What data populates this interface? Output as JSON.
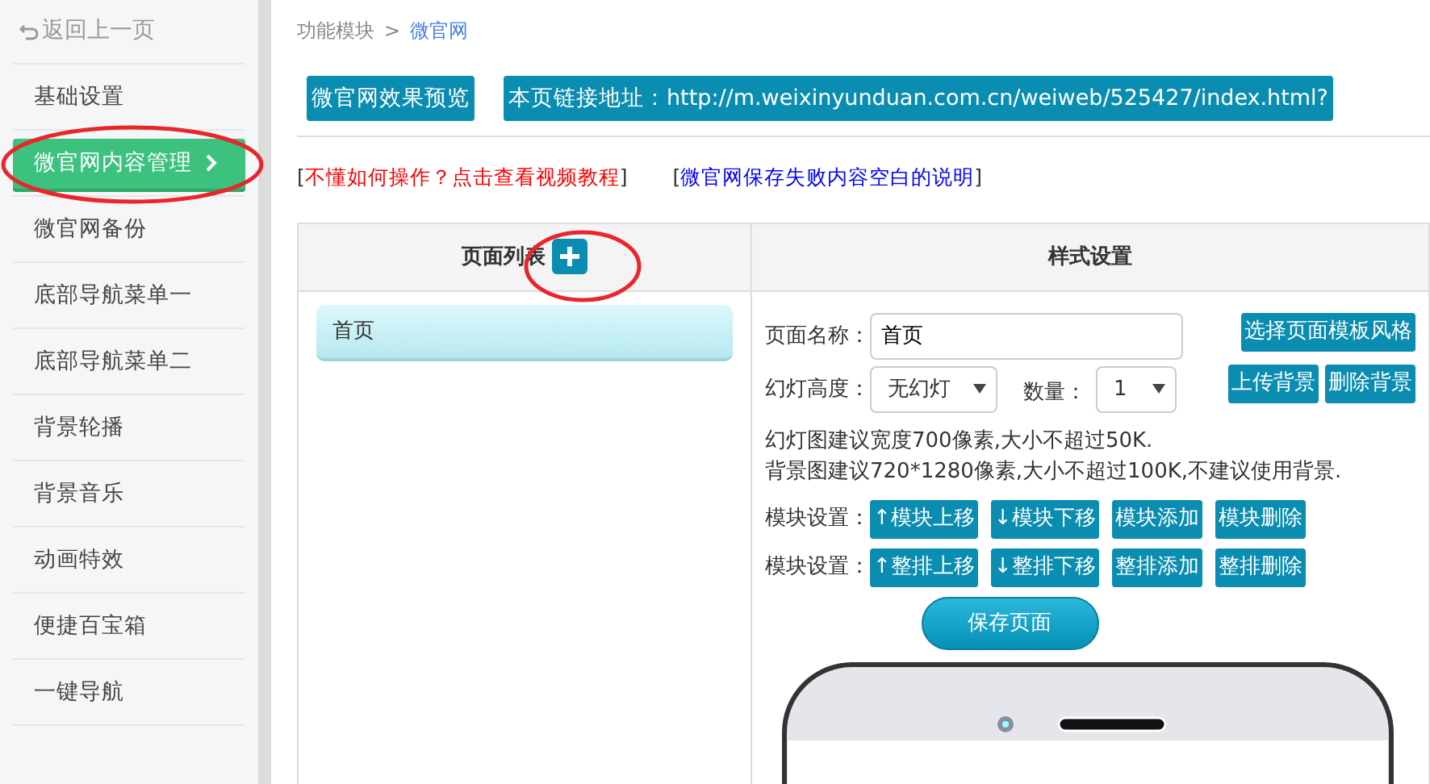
{
  "sidebar": {
    "back_link": "返回上一页",
    "items": [
      {
        "label": "基础设置",
        "selected": false
      },
      {
        "label": "微官网内容管理",
        "selected": true
      },
      {
        "label": "微官网备份",
        "selected": false
      },
      {
        "label": "底部导航菜单一",
        "selected": false
      },
      {
        "label": "底部导航菜单二",
        "selected": false
      },
      {
        "label": "背景轮播",
        "selected": false
      },
      {
        "label": "背景音乐",
        "selected": false
      },
      {
        "label": "动画特效",
        "selected": false
      },
      {
        "label": "便捷百宝箱",
        "selected": false
      },
      {
        "label": "一键导航",
        "selected": false
      }
    ]
  },
  "breadcrumb": {
    "path": "功能模块",
    "separator": ">",
    "current": "微官网"
  },
  "top_buttons": [
    "微官网效果预览",
    "本页链接地址：http://m.weixinyunduan.com.cn/weiweb/525427/index.html?"
  ],
  "help_links": [
    {
      "open": "[",
      "text": "不懂如何操作？点击查看视频教程",
      "close": "]",
      "color": "#ff0000"
    },
    {
      "open": "[",
      "text": "微官网保存失败内容空白的说明",
      "close": "]",
      "color": "#0000ff"
    }
  ],
  "page_list": {
    "title": "页面列表",
    "pages": [
      {
        "label": "首页",
        "selected": true
      }
    ]
  },
  "style_settings": {
    "title": "样式设置",
    "page_name": {
      "label": "页面名称：",
      "value": "首页"
    },
    "template_button": "选择页面模板风格",
    "slide_height": {
      "label": "幻灯高度：",
      "value": "无幻灯"
    },
    "count": {
      "label": "数量：",
      "value": "1"
    },
    "background_buttons": [
      "上传背景",
      "删除背景"
    ],
    "notes": [
      "幻灯图建议宽度700像素,大小不超过50K.",
      "背景图建议720*1280像素,大小不超过100K,不建议使用背景."
    ],
    "module_rows": [
      {
        "label": "模块设置：",
        "buttons": [
          "↑模块上移",
          "↓模块下移",
          "模块添加",
          "模块删除"
        ]
      },
      {
        "label": "模块设置：",
        "buttons": [
          "↑整排上移",
          "↓整排下移",
          "整排添加",
          "整排删除"
        ]
      }
    ],
    "save_button": "保存页面"
  }
}
